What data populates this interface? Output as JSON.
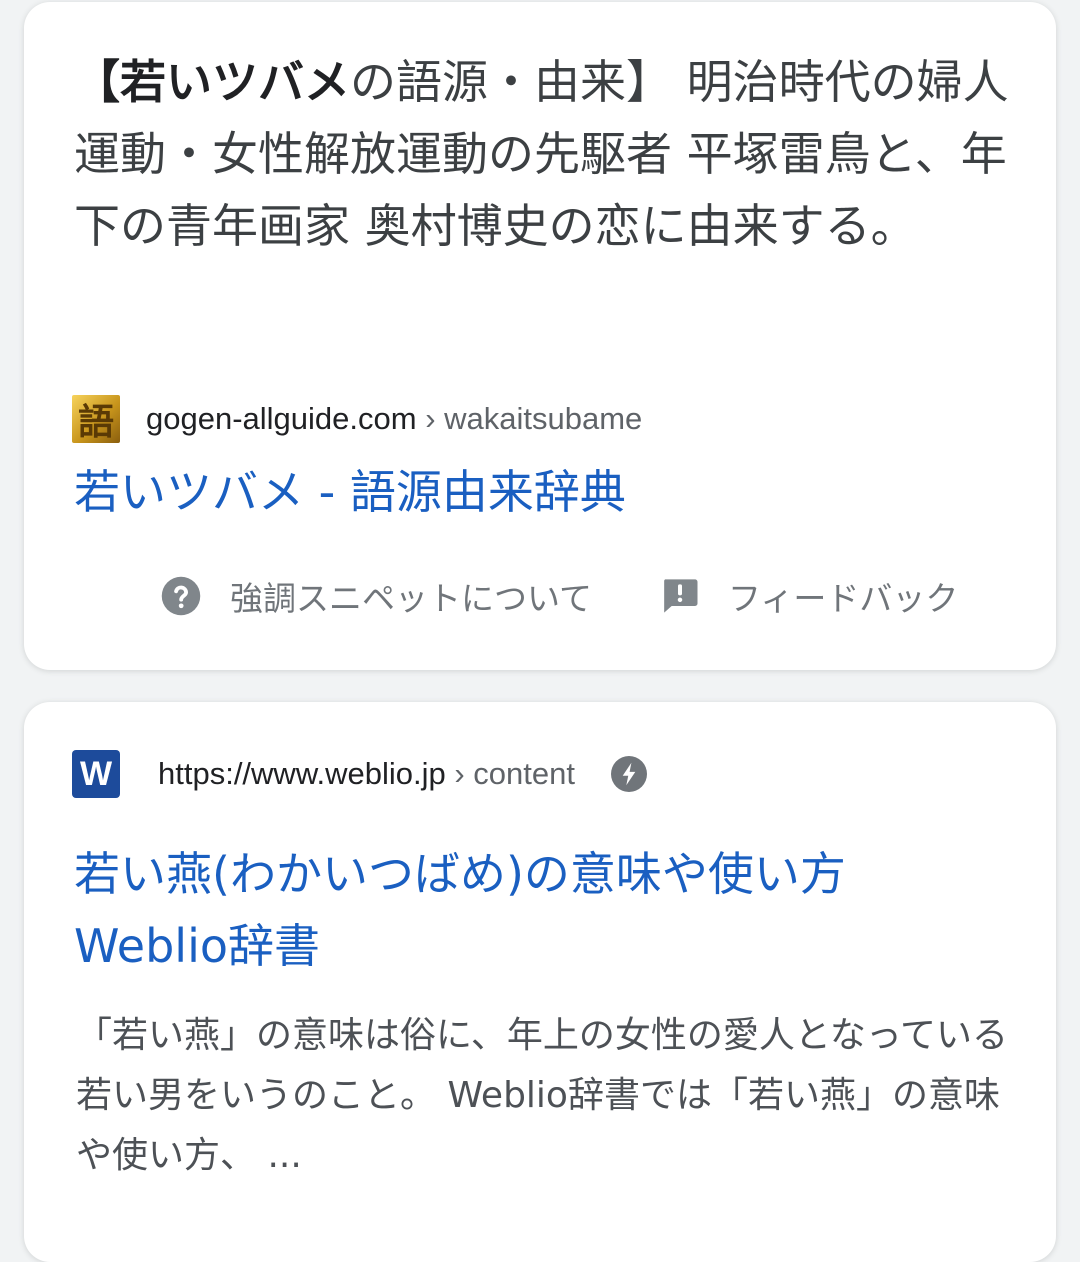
{
  "featured": {
    "snippet_bold": "【若いツバメ",
    "snippet_rest": "の語源・由来】 明治時代の婦人運動・女性解放運動の先駆者 平塚雷鳥と、年下の青年画家 奥村博史の恋に由来する。",
    "favicon_char": "語",
    "site": "gogen-allguide.com",
    "path": " › wakaitsubame",
    "title": "若いツバメ - 語源由来辞典",
    "about_label": "強調スニペットについて",
    "feedback_label": "フィードバック"
  },
  "result2": {
    "favicon_char": "W",
    "site": "https://www.weblio.jp",
    "path": " › content",
    "title": "若い燕(わかいつばめ)の意味や使い方 Weblio辞書",
    "description": "「若い燕」の意味は俗に、年上の女性の愛人となっている若い男をいうのこと。 Weblio辞書では「若い燕」の意味や使い方、 ..."
  },
  "colors": {
    "link": "#1a5fc1",
    "text": "#3c4043",
    "meta": "#70757a",
    "weblio_brand": "#1d4b9b"
  },
  "icons": {
    "about": "help-circle-icon",
    "feedback": "feedback-icon",
    "amp": "amp-lightning-icon"
  }
}
